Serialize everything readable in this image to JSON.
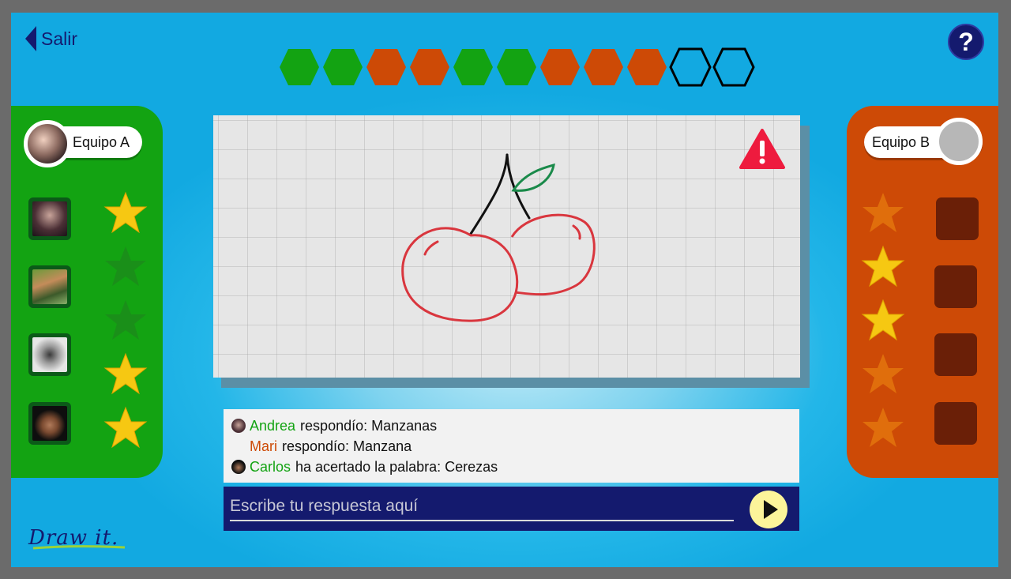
{
  "nav": {
    "back_label": "Salir",
    "help_label": "?"
  },
  "rounds": {
    "states": [
      "won",
      "won",
      "lost",
      "lost",
      "won",
      "won",
      "lost",
      "lost",
      "lost",
      "pending",
      "pending"
    ],
    "colors": {
      "won": "#13a312",
      "lost": "#cd4a06",
      "pending": "none"
    }
  },
  "team_a": {
    "name": "Equipo A",
    "players": [
      {
        "avatar": "player-photo-1",
        "starred": true
      },
      {
        "avatar": "player-photo-2",
        "starred": false
      },
      {
        "avatar": "player-photo-3",
        "starred": false
      },
      {
        "avatar": "player-photo-4",
        "starred": true
      },
      {
        "avatar": "player-photo-5",
        "starred": true
      }
    ],
    "color": "#13a312"
  },
  "team_b": {
    "name": "Equipo B",
    "stars": [
      false,
      true,
      true,
      false,
      false
    ],
    "slots": 4,
    "color": "#cd4a06"
  },
  "canvas": {
    "drawing": "cherries",
    "report_icon": "warning-icon"
  },
  "chat": {
    "messages": [
      {
        "name": "Andrea",
        "name_color": "green",
        "text": "respondío: Manzanas",
        "avatar": true
      },
      {
        "name": "Mari",
        "name_color": "orange",
        "text": "respondío: Manzana",
        "avatar": false
      },
      {
        "name": "Carlos",
        "name_color": "green",
        "text": "ha acertado la palabra: Cerezas",
        "avatar": true
      }
    ]
  },
  "answer": {
    "placeholder": "Escribe tu respuesta aquí",
    "value": ""
  },
  "brand": {
    "logo_text": "DrawIt."
  }
}
